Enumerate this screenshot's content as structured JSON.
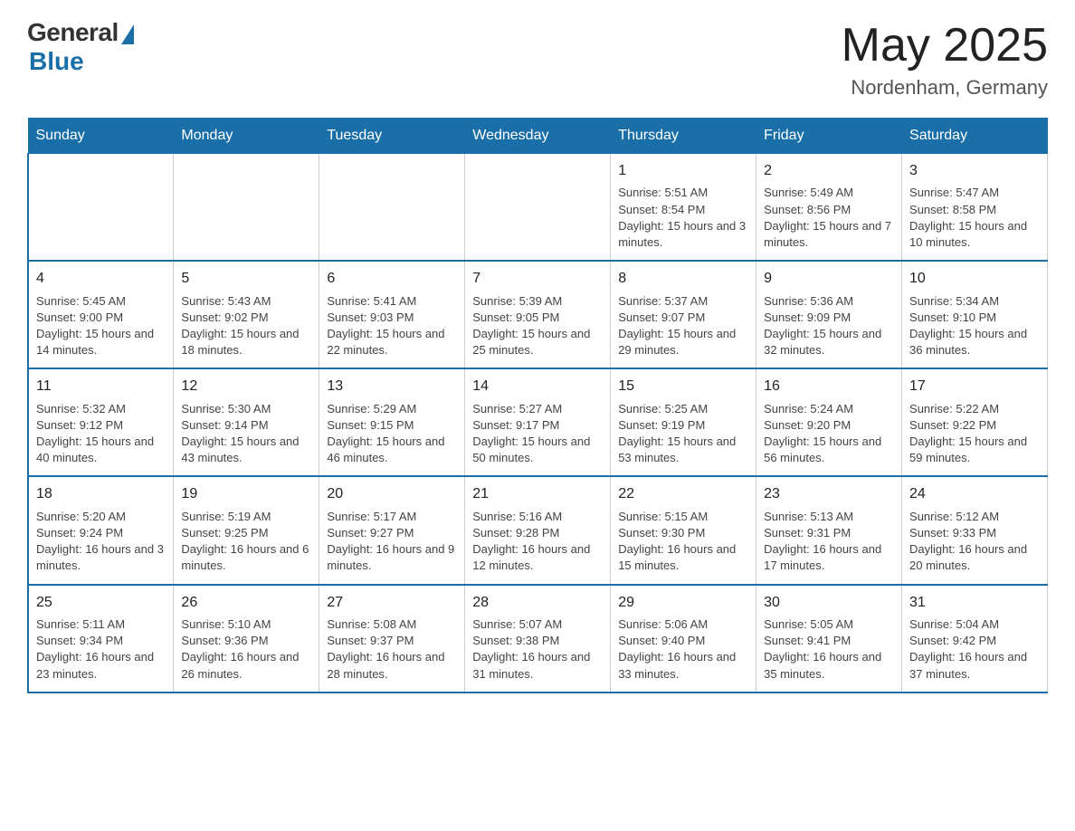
{
  "logo": {
    "general": "General",
    "blue": "Blue"
  },
  "title": "May 2025",
  "location": "Nordenham, Germany",
  "days_header": [
    "Sunday",
    "Monday",
    "Tuesday",
    "Wednesday",
    "Thursday",
    "Friday",
    "Saturday"
  ],
  "weeks": [
    [
      {
        "day": "",
        "info": ""
      },
      {
        "day": "",
        "info": ""
      },
      {
        "day": "",
        "info": ""
      },
      {
        "day": "",
        "info": ""
      },
      {
        "day": "1",
        "info": "Sunrise: 5:51 AM\nSunset: 8:54 PM\nDaylight: 15 hours and 3 minutes."
      },
      {
        "day": "2",
        "info": "Sunrise: 5:49 AM\nSunset: 8:56 PM\nDaylight: 15 hours and 7 minutes."
      },
      {
        "day": "3",
        "info": "Sunrise: 5:47 AM\nSunset: 8:58 PM\nDaylight: 15 hours and 10 minutes."
      }
    ],
    [
      {
        "day": "4",
        "info": "Sunrise: 5:45 AM\nSunset: 9:00 PM\nDaylight: 15 hours and 14 minutes."
      },
      {
        "day": "5",
        "info": "Sunrise: 5:43 AM\nSunset: 9:02 PM\nDaylight: 15 hours and 18 minutes."
      },
      {
        "day": "6",
        "info": "Sunrise: 5:41 AM\nSunset: 9:03 PM\nDaylight: 15 hours and 22 minutes."
      },
      {
        "day": "7",
        "info": "Sunrise: 5:39 AM\nSunset: 9:05 PM\nDaylight: 15 hours and 25 minutes."
      },
      {
        "day": "8",
        "info": "Sunrise: 5:37 AM\nSunset: 9:07 PM\nDaylight: 15 hours and 29 minutes."
      },
      {
        "day": "9",
        "info": "Sunrise: 5:36 AM\nSunset: 9:09 PM\nDaylight: 15 hours and 32 minutes."
      },
      {
        "day": "10",
        "info": "Sunrise: 5:34 AM\nSunset: 9:10 PM\nDaylight: 15 hours and 36 minutes."
      }
    ],
    [
      {
        "day": "11",
        "info": "Sunrise: 5:32 AM\nSunset: 9:12 PM\nDaylight: 15 hours and 40 minutes."
      },
      {
        "day": "12",
        "info": "Sunrise: 5:30 AM\nSunset: 9:14 PM\nDaylight: 15 hours and 43 minutes."
      },
      {
        "day": "13",
        "info": "Sunrise: 5:29 AM\nSunset: 9:15 PM\nDaylight: 15 hours and 46 minutes."
      },
      {
        "day": "14",
        "info": "Sunrise: 5:27 AM\nSunset: 9:17 PM\nDaylight: 15 hours and 50 minutes."
      },
      {
        "day": "15",
        "info": "Sunrise: 5:25 AM\nSunset: 9:19 PM\nDaylight: 15 hours and 53 minutes."
      },
      {
        "day": "16",
        "info": "Sunrise: 5:24 AM\nSunset: 9:20 PM\nDaylight: 15 hours and 56 minutes."
      },
      {
        "day": "17",
        "info": "Sunrise: 5:22 AM\nSunset: 9:22 PM\nDaylight: 15 hours and 59 minutes."
      }
    ],
    [
      {
        "day": "18",
        "info": "Sunrise: 5:20 AM\nSunset: 9:24 PM\nDaylight: 16 hours and 3 minutes."
      },
      {
        "day": "19",
        "info": "Sunrise: 5:19 AM\nSunset: 9:25 PM\nDaylight: 16 hours and 6 minutes."
      },
      {
        "day": "20",
        "info": "Sunrise: 5:17 AM\nSunset: 9:27 PM\nDaylight: 16 hours and 9 minutes."
      },
      {
        "day": "21",
        "info": "Sunrise: 5:16 AM\nSunset: 9:28 PM\nDaylight: 16 hours and 12 minutes."
      },
      {
        "day": "22",
        "info": "Sunrise: 5:15 AM\nSunset: 9:30 PM\nDaylight: 16 hours and 15 minutes."
      },
      {
        "day": "23",
        "info": "Sunrise: 5:13 AM\nSunset: 9:31 PM\nDaylight: 16 hours and 17 minutes."
      },
      {
        "day": "24",
        "info": "Sunrise: 5:12 AM\nSunset: 9:33 PM\nDaylight: 16 hours and 20 minutes."
      }
    ],
    [
      {
        "day": "25",
        "info": "Sunrise: 5:11 AM\nSunset: 9:34 PM\nDaylight: 16 hours and 23 minutes."
      },
      {
        "day": "26",
        "info": "Sunrise: 5:10 AM\nSunset: 9:36 PM\nDaylight: 16 hours and 26 minutes."
      },
      {
        "day": "27",
        "info": "Sunrise: 5:08 AM\nSunset: 9:37 PM\nDaylight: 16 hours and 28 minutes."
      },
      {
        "day": "28",
        "info": "Sunrise: 5:07 AM\nSunset: 9:38 PM\nDaylight: 16 hours and 31 minutes."
      },
      {
        "day": "29",
        "info": "Sunrise: 5:06 AM\nSunset: 9:40 PM\nDaylight: 16 hours and 33 minutes."
      },
      {
        "day": "30",
        "info": "Sunrise: 5:05 AM\nSunset: 9:41 PM\nDaylight: 16 hours and 35 minutes."
      },
      {
        "day": "31",
        "info": "Sunrise: 5:04 AM\nSunset: 9:42 PM\nDaylight: 16 hours and 37 minutes."
      }
    ]
  ]
}
